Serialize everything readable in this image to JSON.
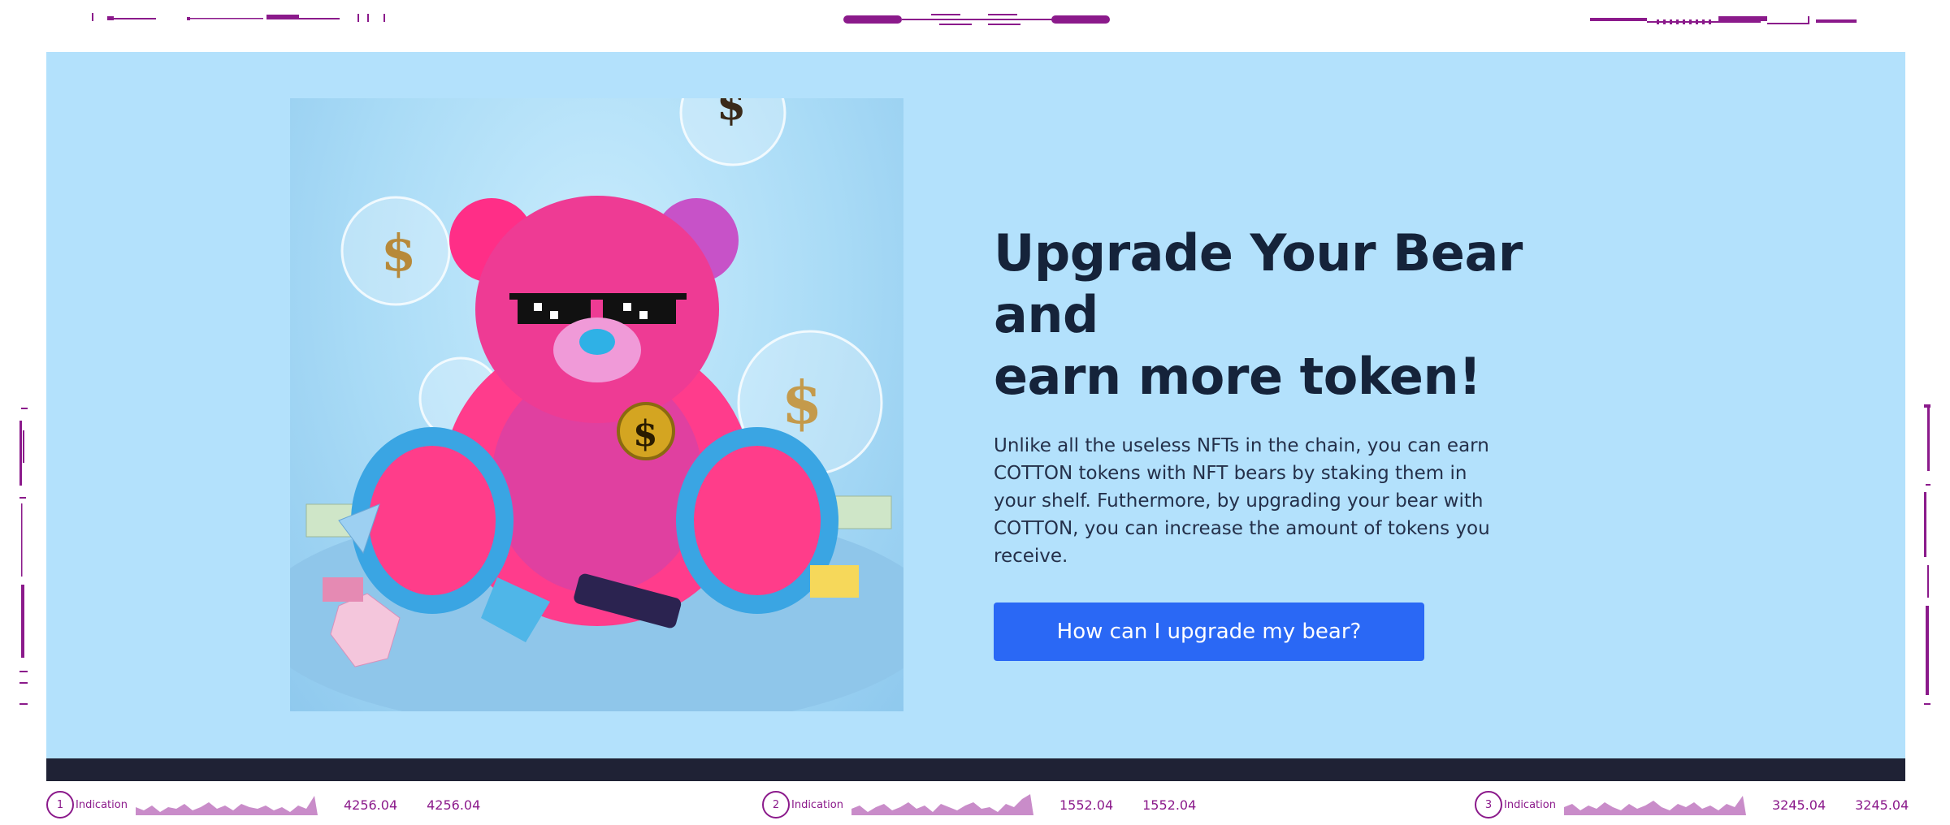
{
  "hero": {
    "heading_line1": "Upgrade Your Bear and",
    "heading_line2": "earn more token!",
    "description": "Unlike all the useless NFTs in the chain, you can earn COTTON tokens with NFT bears by staking them in your shelf. Futhermore, by upgrading your bear with COTTON, you can increase the amount of tokens you receive.",
    "cta_label": "How can I upgrade my bear?",
    "background_color": "#b3e1fc",
    "cta_color": "#2a68f5",
    "image_icon": "pink-teddy-bear-image"
  },
  "indications": [
    {
      "number": "1",
      "label": "Indication",
      "value_a": "4256.04",
      "value_b": "4256.04"
    },
    {
      "number": "2",
      "label": "Indication",
      "value_a": "1552.04",
      "value_b": "1552.04"
    },
    {
      "number": "3",
      "label": "Indication",
      "value_a": "3245.04",
      "value_b": "3245.04"
    }
  ],
  "colors": {
    "hud_accent": "#8b1a8b",
    "footer_strip": "#1f2235"
  }
}
